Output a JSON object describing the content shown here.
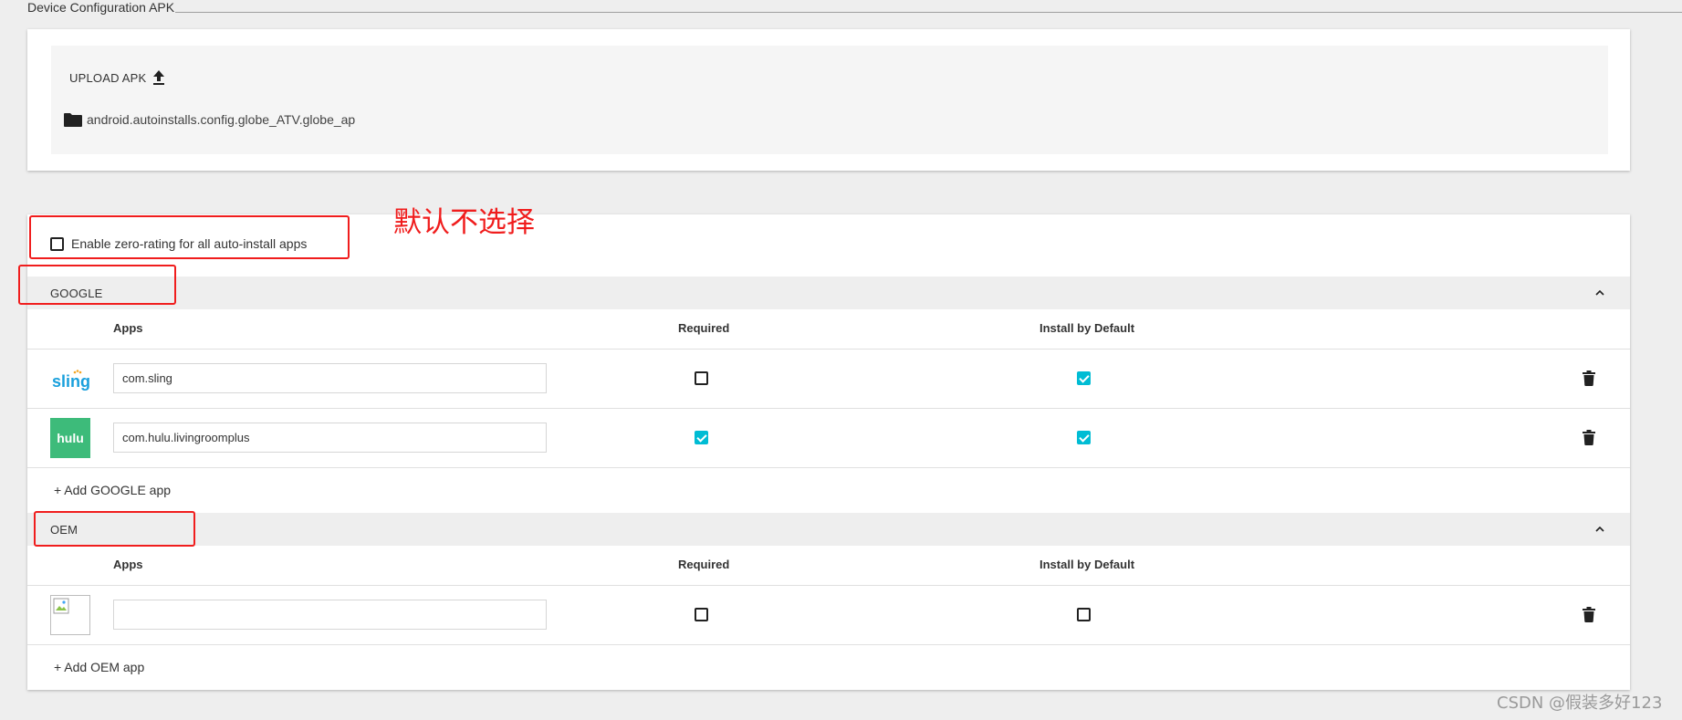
{
  "page": {
    "section_title": "Device Configuration APK"
  },
  "upload": {
    "button_label": "UPLOAD APK",
    "file_name": "android.autoinstalls.config.globe_ATV.globe_ap"
  },
  "zero_rating": {
    "label": "Enable zero-rating for all auto-install apps",
    "checked": false
  },
  "columns": {
    "apps": "Apps",
    "required": "Required",
    "install_default": "Install by Default"
  },
  "groups": {
    "google": {
      "title": "GOOGLE",
      "add_label": "+ Add GOOGLE app",
      "apps": [
        {
          "logo": "sling",
          "package": "com.sling",
          "required": false,
          "install_by_default": true
        },
        {
          "logo": "hulu",
          "package": "com.hulu.livingroomplus",
          "required": true,
          "install_by_default": true
        }
      ]
    },
    "oem": {
      "title": "OEM",
      "add_label": "+ Add OEM app",
      "apps": [
        {
          "logo": "broken-image",
          "package": "",
          "required": false,
          "install_by_default": false
        }
      ]
    }
  },
  "annotation": {
    "text": "默认不选择",
    "color": "#f01d1d"
  },
  "watermark": "CSDN @假装多好123",
  "colors": {
    "accent": "#00bcd4",
    "annotation": "#f01d1d",
    "hulu_green": "#3dbb7a",
    "sling_blue": "#1aa0dc"
  }
}
